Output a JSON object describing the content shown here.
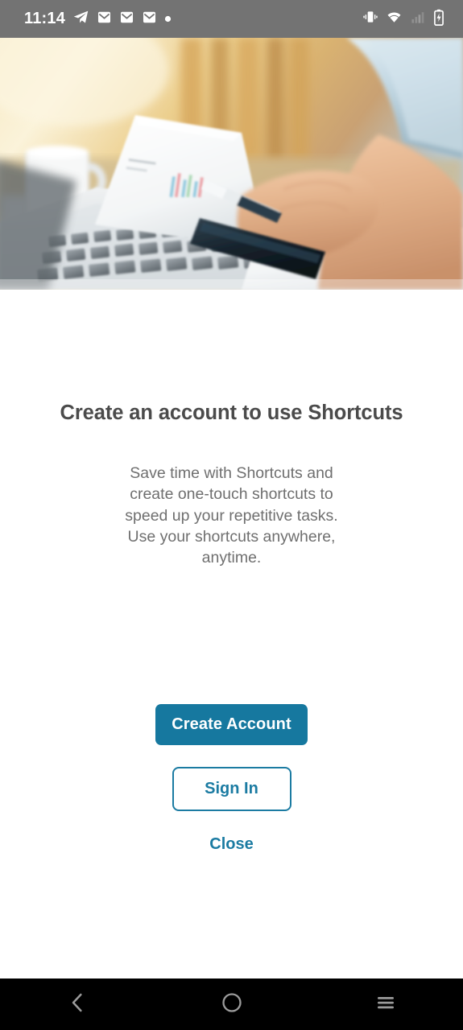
{
  "status_bar": {
    "time": "11:14",
    "background": "#737373",
    "left_icons": [
      "telegram-icon",
      "mail-icon",
      "mail-icon",
      "mail-icon",
      "dot-icon"
    ],
    "right_icons": [
      "vibrate-icon",
      "wifi-icon",
      "signal-icon",
      "battery-charging-icon"
    ]
  },
  "hero": {
    "alt": "Person holding a smartphone over a laptop keyboard with printed chart documents and a coffee mug"
  },
  "main": {
    "headline": "Create an account to use Shortcuts",
    "subtext": "Save time with Shortcuts and create one-touch shortcuts to speed up your repetitive tasks. Use your shortcuts anywhere, anytime.",
    "primary_button": "Create Account",
    "secondary_button": "Sign In",
    "link_button": "Close"
  },
  "colors": {
    "accent": "#16789f",
    "accent_outline": "#1b7ba2",
    "headline_text": "#4b4b4b",
    "body_text": "#6f6f6f",
    "status_bar": "#737373",
    "nav_bar": "#000000"
  },
  "nav_bar": {
    "items": [
      "back-icon",
      "home-icon",
      "recents-icon"
    ]
  }
}
